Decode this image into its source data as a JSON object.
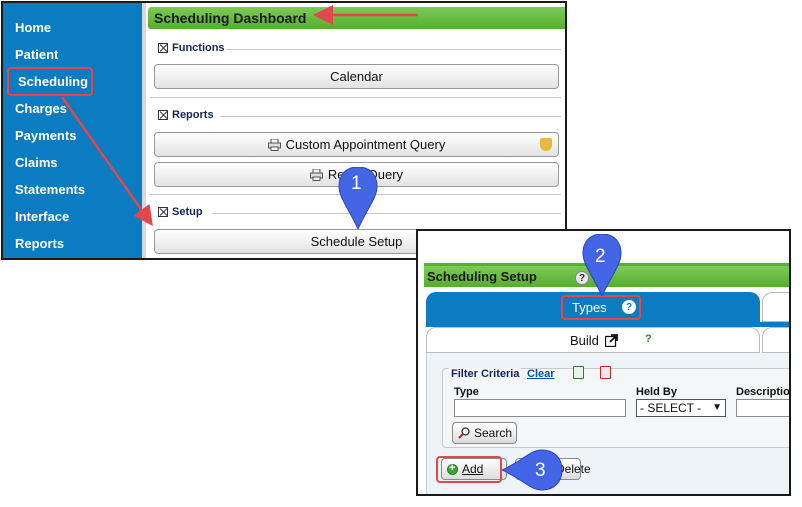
{
  "sidebar": {
    "items": [
      {
        "label": "Home"
      },
      {
        "label": "Patient"
      },
      {
        "label": "Scheduling"
      },
      {
        "label": "Charges"
      },
      {
        "label": "Payments"
      },
      {
        "label": "Claims"
      },
      {
        "label": "Statements"
      },
      {
        "label": "Interface"
      },
      {
        "label": "Reports"
      }
    ]
  },
  "dashboard": {
    "title": "Scheduling Dashboard",
    "sections": {
      "functions": {
        "label": "Functions",
        "buttons": [
          "Calendar"
        ]
      },
      "reports": {
        "label": "Reports",
        "buttons": [
          "Custom Appointment Query",
          "Recall Query"
        ]
      },
      "setup": {
        "label": "Setup",
        "buttons": [
          "Schedule Setup"
        ]
      }
    }
  },
  "setup": {
    "title": "Scheduling Setup",
    "help": "?",
    "tabs": {
      "types_label": "Types",
      "build_label": "Build",
      "build_help": "?"
    },
    "filter": {
      "title": "Filter Criteria",
      "clear": "Clear",
      "type_label": "Type",
      "held_by_label": "Held By",
      "held_by_value": "- SELECT -",
      "description_label": "Description",
      "search_button": "Search"
    },
    "actions": {
      "add_button": "Add",
      "delete_button": "Delete"
    }
  },
  "annotations": {
    "markers": [
      "1",
      "2",
      "3"
    ]
  },
  "colors": {
    "sidebar": "#0b7cc1",
    "header_green": "#56ad2e",
    "highlight": "#e2474b",
    "marker": "#4466e6"
  }
}
